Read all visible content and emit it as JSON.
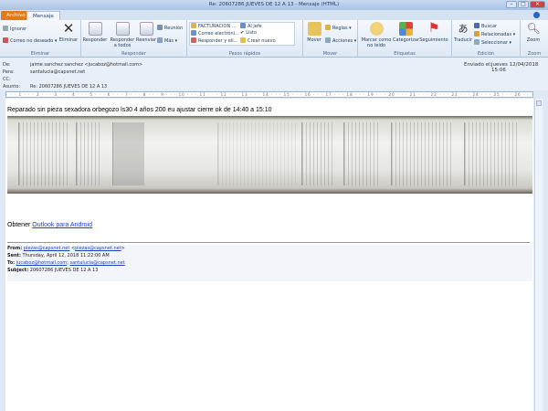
{
  "window": {
    "title": "Re: 20607286 JUEVES DE 12 A 13  -  Mensaje (HTML)"
  },
  "tabs": [
    "Archivo",
    "Mensaje"
  ],
  "ribbon": {
    "eliminar": {
      "label": "Eliminar",
      "ignorar": "Ignorar",
      "correo_no_deseado": "Correo no deseado",
      "eliminar": "Eliminar"
    },
    "responder": {
      "label": "Responder",
      "responder": "Responder",
      "responder_todos": "Responder a todos",
      "reenviar": "Reenviar",
      "reunion": "Reunión",
      "mas": "Más"
    },
    "pasos": {
      "label": "Pasos rápidos",
      "items": [
        "FACTURACION ...",
        "Correo electróni...",
        "Responder y eli...",
        "Al jefe",
        "Listo",
        "Crear nuevo"
      ]
    },
    "mover": {
      "label": "Mover",
      "mover": "Mover",
      "reglas": "Reglas",
      "acciones": "Acciones"
    },
    "etiquetas": {
      "label": "Etiquetas",
      "marcar": "Marcar como no leído",
      "categorizar": "Categorizar",
      "seguimiento": "Seguimiento"
    },
    "edicion": {
      "label": "Edición",
      "traducir": "Traducir",
      "buscar": "Buscar",
      "relacionadas": "Relacionadas",
      "seleccionar": "Seleccionar"
    },
    "zoom": {
      "label": "Zoom",
      "zoom": "Zoom"
    }
  },
  "header": {
    "de_label": "De:",
    "de": "jaime sanchez sanchez <jucaboz@hotmail.com>",
    "para_label": "Para:",
    "para": "santalucia@capsnet.net",
    "cc_label": "CC:",
    "asunto_label": "Asunto:",
    "asunto": "Re: 20607286 JUEVES DE 12 A 13",
    "enviado_label": "Enviado el:",
    "enviado": "jueves 12/04/2018 15:06"
  },
  "body": {
    "text": "Reparado sin pieza sexadora orbegozo ls30 4 años 200 eu ajustar cierre ok de 14:40 a 15:10",
    "obtener": "Obtener ",
    "outlook_link": "Outlook para Android",
    "fwd": {
      "from_label": "From:",
      "from_email": "piezas@capsnet.net",
      "from_email2": "piezas@capsnet.net",
      "sent_label": "Sent:",
      "sent": "Thursday, April 12, 2018 11:22:00 AM",
      "to_label": "To:",
      "to1": "jucaboz@hotmail.com",
      "to2": "santalucia@capsnet.net",
      "subject_label": "Subject:",
      "subject": "20607286 JUEVES DE 12 A 13"
    }
  }
}
